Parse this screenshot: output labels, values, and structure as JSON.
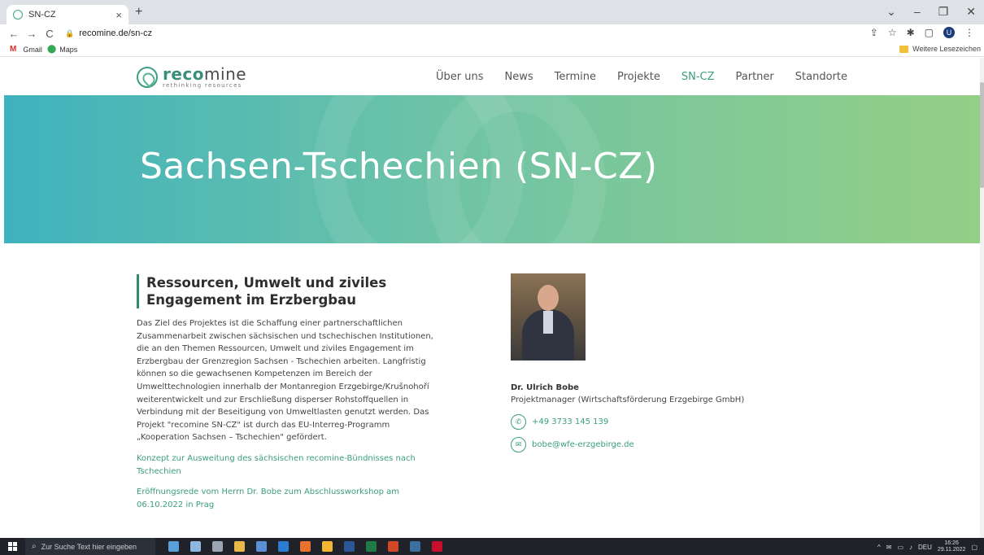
{
  "browser": {
    "tab_title": "SN-CZ",
    "tab_close": "×",
    "new_tab": "+",
    "url": "recomine.de/sn-cz",
    "bookmarks": [
      {
        "label": "Gmail"
      },
      {
        "label": "Maps"
      }
    ],
    "other_bookmarks": "Weitere Lesezeichen",
    "profile_initial": "U",
    "window_controls": [
      "⌄",
      "–",
      "❐",
      "✕"
    ]
  },
  "site": {
    "logo_name_bold": "reco",
    "logo_name_rest": "mine",
    "logo_tagline": "rethinking resources",
    "nav": [
      {
        "label": "Über uns"
      },
      {
        "label": "News"
      },
      {
        "label": "Termine"
      },
      {
        "label": "Projekte"
      },
      {
        "label": "SN-CZ",
        "active": true
      },
      {
        "label": "Partner"
      },
      {
        "label": "Standorte"
      }
    ],
    "hero_title": "Sachsen-Tschechien (SN-CZ)",
    "section_heading": "Ressourcen, Umwelt und ziviles Engagement im Erzbergbau",
    "paragraph": "Das Ziel des Projektes ist die Schaffung einer partnerschaftlichen Zusammenarbeit zwischen sächsischen und tschechischen Institutionen, die an den Themen Ressourcen, Umwelt und ziviles Engagement im Erzbergbau der Grenzregion Sachsen - Tschechien arbeiten. Langfristig können so die gewachsenen Kompetenzen im Bereich der Umwelttechnologien innerhalb der Montanregion Erzgebirge/Krušnohoří weiterentwickelt und zur Erschließung disperser Rohstoffquellen in Verbindung mit der Beseitigung von Umweltlasten genutzt werden. Das Projekt \"recomine SN-CZ\" ist durch das EU-Interreg-Programm „Kooperation Sachsen – Tschechien\" gefördert.",
    "links": [
      {
        "label": "Konzept zur Ausweitung des sächsischen recomine-Bündnisses nach Tschechien"
      },
      {
        "label": "Eröffnungsrede vom Herrn Dr. Bobe zum Abschlussworkshop am 06.10.2022 in Prag"
      }
    ],
    "contact": {
      "name": "Dr. Ulrich Bobe",
      "role": "Projektmanager (Wirtschaftsförderung Erzgebirge GmbH)",
      "phone": "+49 3733 145 139",
      "email": "bobe@wfe-erzgebirge.de"
    }
  },
  "taskbar": {
    "search_placeholder": "Zur Suche Text hier eingeben",
    "language": "DEU",
    "time": "16:26",
    "date": "29.11.2022"
  },
  "colors": {
    "accent": "#3a9e7e",
    "hero_start": "#3fb2bd",
    "hero_end": "#94cf86"
  }
}
